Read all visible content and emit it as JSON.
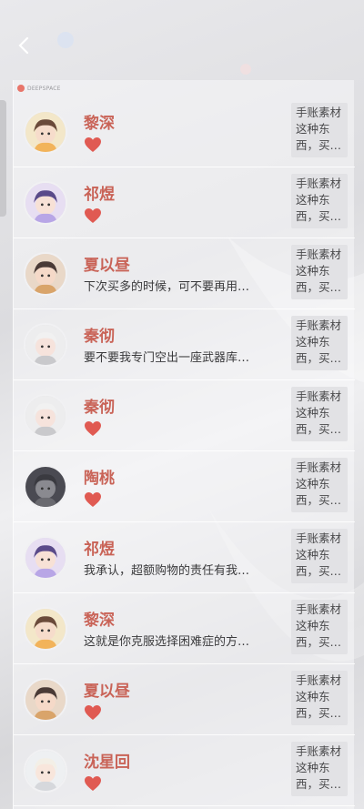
{
  "header": {
    "back_icon": "chevron-left-icon",
    "brand": "DEEPSPACE"
  },
  "colors": {
    "name": "#c96357",
    "heart": "#e05a52",
    "text": "#3a3a3c"
  },
  "rows": [
    {
      "name": "黎深",
      "message": "",
      "liked": true,
      "thumb": [
        "手账素材",
        "这种东",
        "西，买…"
      ],
      "avatar": "a1"
    },
    {
      "name": "祁煜",
      "message": "",
      "liked": true,
      "thumb": [
        "手账素材",
        "这种东",
        "西，买…"
      ],
      "avatar": "a2"
    },
    {
      "name": "夏以昼",
      "message": "下次买多的时候，可不要再用…",
      "liked": false,
      "thumb": [
        "手账素材",
        "这种东",
        "西，买…"
      ],
      "avatar": "a3"
    },
    {
      "name": "秦彻",
      "message": "要不要我专门空出一座武器库…",
      "liked": false,
      "thumb": [
        "手账素材",
        "这种东",
        "西，买…"
      ],
      "avatar": "a4"
    },
    {
      "name": "秦彻",
      "message": "",
      "liked": true,
      "thumb": [
        "手账素材",
        "这种东",
        "西，买…"
      ],
      "avatar": "a4"
    },
    {
      "name": "陶桃",
      "message": "",
      "liked": true,
      "thumb": [
        "手账素材",
        "这种东",
        "西，买…"
      ],
      "avatar": "a5"
    },
    {
      "name": "祁煜",
      "message": "我承认，超额购物的责任有我…",
      "liked": false,
      "thumb": [
        "手账素材",
        "这种东",
        "西，买…"
      ],
      "avatar": "a2"
    },
    {
      "name": "黎深",
      "message": "这就是你克服选择困难症的方…",
      "liked": false,
      "thumb": [
        "手账素材",
        "这种东",
        "西，买…"
      ],
      "avatar": "a1"
    },
    {
      "name": "夏以昼",
      "message": "",
      "liked": true,
      "thumb": [
        "手账素材",
        "这种东",
        "西，买…"
      ],
      "avatar": "a3"
    },
    {
      "name": "沈星回",
      "message": "",
      "liked": true,
      "thumb": [
        "手账素材",
        "这种东",
        "西，买…"
      ],
      "avatar": "a6"
    }
  ]
}
